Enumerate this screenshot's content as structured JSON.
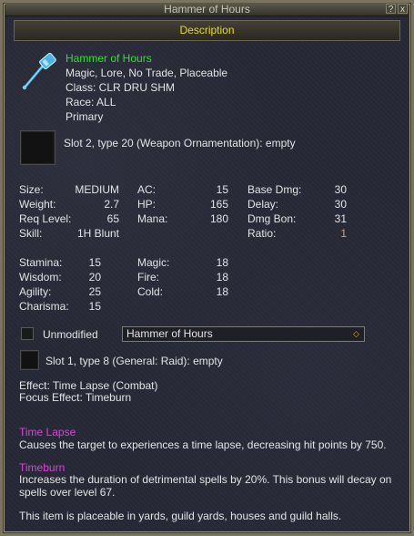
{
  "window": {
    "title": "Hammer of Hours",
    "help_label": "?",
    "close_label": "x"
  },
  "tab": {
    "label": "Description"
  },
  "item": {
    "name": "Hammer of Hours",
    "flags": "Magic, Lore, No Trade, Placeable",
    "class_line": "Class: CLR DRU SHM",
    "race_line": "Race: ALL",
    "slot_line": "Primary"
  },
  "ornament_slot": {
    "text": "Slot 2, type 20 (Weapon Ornamentation): empty"
  },
  "stats_col1": [
    {
      "label": "Size:",
      "value": "MEDIUM"
    },
    {
      "label": "Weight:",
      "value": "2.7"
    },
    {
      "label": "Req Level:",
      "value": "65"
    },
    {
      "label": "Skill:",
      "value": "1H Blunt"
    }
  ],
  "stats_col2": [
    {
      "label": "AC:",
      "value": "15"
    },
    {
      "label": "HP:",
      "value": "165"
    },
    {
      "label": "Mana:",
      "value": "180"
    }
  ],
  "stats_col3": [
    {
      "label": "Base Dmg:",
      "value": "30"
    },
    {
      "label": "Delay:",
      "value": "30"
    },
    {
      "label": "Dmg Bon:",
      "value": "31"
    },
    {
      "label": "Ratio:",
      "value": "1"
    }
  ],
  "attrs_col1": [
    {
      "label": "Stamina:",
      "value": "15"
    },
    {
      "label": "Wisdom:",
      "value": "20"
    },
    {
      "label": "Agility:",
      "value": "25"
    },
    {
      "label": "Charisma:",
      "value": "15"
    }
  ],
  "attrs_col2": [
    {
      "label": "Magic:",
      "value": "18"
    },
    {
      "label": "Fire:",
      "value": "18"
    },
    {
      "label": "Cold:",
      "value": "18"
    }
  ],
  "appearance": {
    "checkbox_label": "Unmodified",
    "select_value": "Hammer of Hours"
  },
  "aug_slot": {
    "text": "Slot 1, type 8 (General: Raid): empty"
  },
  "effects": {
    "effect_line": "Effect: Time Lapse (Combat)",
    "focus_line": "Focus Effect: Timeburn"
  },
  "spells": [
    {
      "name": "Time Lapse",
      "desc": "Causes the target to experiences a time lapse, decreasing hit points by 750."
    },
    {
      "name": "Timeburn",
      "desc": "Increases the duration of detrimental spells by 20%. This bonus will decay on spells over level 67."
    }
  ],
  "footer": {
    "text": "This item is placeable in yards, guild yards, houses and guild halls."
  },
  "colors": {
    "item_name": "#33e033",
    "spell_name": "#e040e0",
    "tab_label": "#e8d820",
    "ratio": "#d6a07a"
  }
}
